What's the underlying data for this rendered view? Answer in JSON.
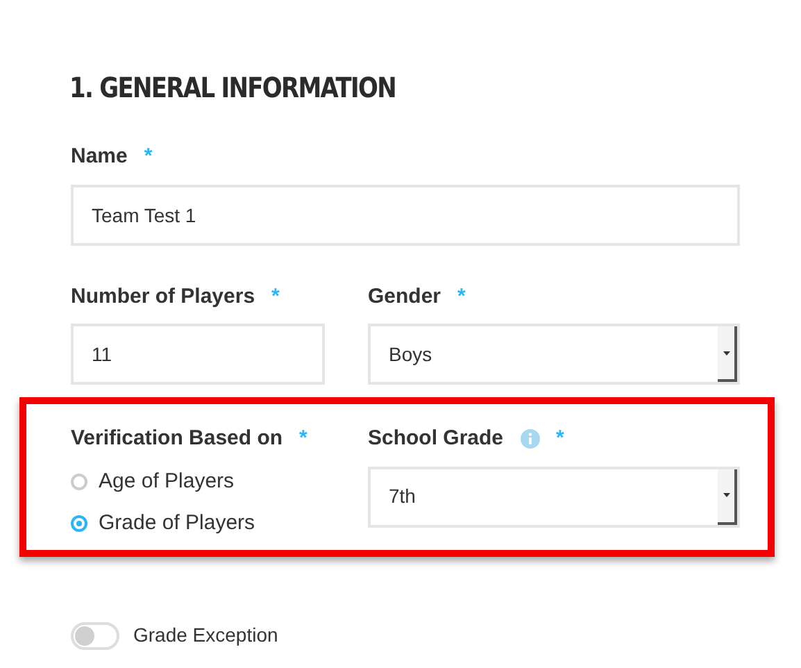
{
  "section_title": "1. GENERAL INFORMATION",
  "name_field": {
    "label": "Name",
    "required_mark": "*",
    "value": "Team Test 1"
  },
  "players_field": {
    "label": "Number of Players",
    "required_mark": "*",
    "value": "11"
  },
  "gender_field": {
    "label": "Gender",
    "required_mark": "*",
    "value": "Boys"
  },
  "verification": {
    "label": "Verification Based on",
    "required_mark": "*",
    "options": [
      {
        "label": "Age of Players",
        "selected": false
      },
      {
        "label": "Grade of Players",
        "selected": true
      }
    ]
  },
  "grade_field": {
    "label": "School Grade",
    "required_mark": "*",
    "value": "7th"
  },
  "grade_exception": {
    "label": "Grade Exception",
    "on": false
  }
}
